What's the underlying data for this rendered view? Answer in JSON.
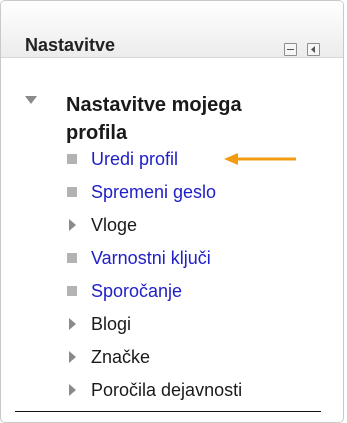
{
  "block": {
    "title": "Nastavitve",
    "section_title": "Nastavitve mojega profila",
    "items": [
      {
        "label": "Uredi profil",
        "type": "link"
      },
      {
        "label": "Spremeni geslo",
        "type": "link"
      },
      {
        "label": "Vloge",
        "type": "branch"
      },
      {
        "label": "Varnostni ključi",
        "type": "link"
      },
      {
        "label": "Sporočanje",
        "type": "link"
      },
      {
        "label": "Blogi",
        "type": "branch"
      },
      {
        "label": "Značke",
        "type": "branch"
      },
      {
        "label": "Poročila dejavnosti",
        "type": "branch"
      }
    ]
  },
  "colors": {
    "link": "#2020c8",
    "arrow": "#f39c12"
  },
  "icons": {
    "minimize": "minimize-icon",
    "dock": "dock-icon",
    "expanded": "caret-down-icon",
    "leaf": "square-bullet-icon",
    "branch": "caret-right-icon",
    "annotation": "arrow-left-icon"
  }
}
